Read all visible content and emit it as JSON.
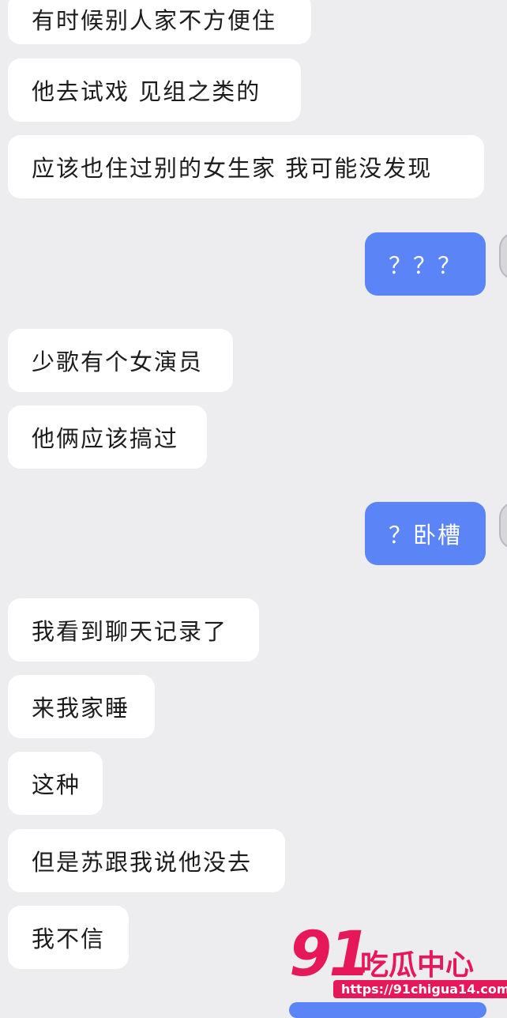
{
  "messages": [
    {
      "direction": "in",
      "text": "有时候别人家不方便住"
    },
    {
      "direction": "in",
      "text": "他去试戏 见组之类的"
    },
    {
      "direction": "in",
      "text": "应该也住过别的女生家 我可能没发现"
    },
    {
      "direction": "out",
      "text": "？？？"
    },
    {
      "direction": "in",
      "text": "少歌有个女演员"
    },
    {
      "direction": "in",
      "text": "他俩应该搞过"
    },
    {
      "direction": "out",
      "text": "？卧槽"
    },
    {
      "direction": "in",
      "text": "我看到聊天记录了"
    },
    {
      "direction": "in",
      "text": "来我家睡"
    },
    {
      "direction": "in",
      "text": "这种"
    },
    {
      "direction": "in",
      "text": "但是苏跟我说他没去"
    },
    {
      "direction": "in",
      "text": "我不信"
    }
  ],
  "watermark": {
    "number": "91",
    "brand": "吃瓜中心",
    "url": "https://91chigua14.com"
  },
  "colors": {
    "background": "#ededf0",
    "incoming_bubble": "#ffffff",
    "outgoing_bubble": "#5b84f7",
    "watermark": "#e6185a"
  }
}
